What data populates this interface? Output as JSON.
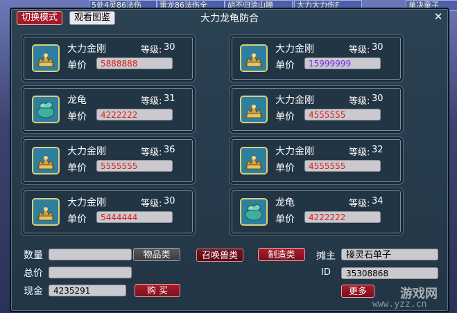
{
  "background": {
    "strips": [
      "5处4灵86法伤",
      "雷龙86法伤全",
      "胡不归涂山瞳",
      "大力大力伤F",
      "单决童子"
    ]
  },
  "window": {
    "title": "大力龙龟防合",
    "tab_switch": "切换模式",
    "tab_view": "观看图鉴",
    "close": "✕"
  },
  "labels": {
    "level": "等级:",
    "price": "单价"
  },
  "listings": [
    {
      "name": "大力金刚",
      "level": "30",
      "price": "5888888",
      "price_color": "red",
      "icon": "golden-beast-icon"
    },
    {
      "name": "大力金刚",
      "level": "30",
      "price": "15999999",
      "price_color": "purple",
      "icon": "golden-beast-icon"
    },
    {
      "name": "龙龟",
      "level": "31",
      "price": "4222222",
      "price_color": "red",
      "icon": "dragon-turtle-icon"
    },
    {
      "name": "大力金刚",
      "level": "30",
      "price": "4555555",
      "price_color": "red",
      "icon": "golden-beast-icon"
    },
    {
      "name": "大力金刚",
      "level": "36",
      "price": "5555555",
      "price_color": "red",
      "icon": "golden-beast-icon"
    },
    {
      "name": "大力金刚",
      "level": "32",
      "price": "4555555",
      "price_color": "red",
      "icon": "golden-beast-icon"
    },
    {
      "name": "大力金刚",
      "level": "30",
      "price": "5444444",
      "price_color": "red",
      "icon": "golden-beast-icon"
    },
    {
      "name": "龙龟",
      "level": "34",
      "price": "4222222",
      "price_color": "red",
      "icon": "dragon-turtle-icon"
    }
  ],
  "bottom": {
    "quantity_label": "数量",
    "quantity_value": "",
    "total_label": "总价",
    "total_value": "",
    "cash_label": "现金",
    "cash_value": "4235291",
    "buy_button": "购 买",
    "items_button": "物品类",
    "summon_button": "召唤兽类",
    "craft_button": "制造类",
    "owner_label": "摊主",
    "owner_value": "接灵石单子",
    "id_label": "ID",
    "id_value": "35308868",
    "more_button": "更多"
  },
  "watermark": {
    "text": "游戏网",
    "url": "www.yzz.cn"
  },
  "colors": {
    "price_red": "#e0201c",
    "price_purple": "#7a1ee0",
    "window_bg": "#243a4c",
    "tab_red": "#a41a2a"
  }
}
